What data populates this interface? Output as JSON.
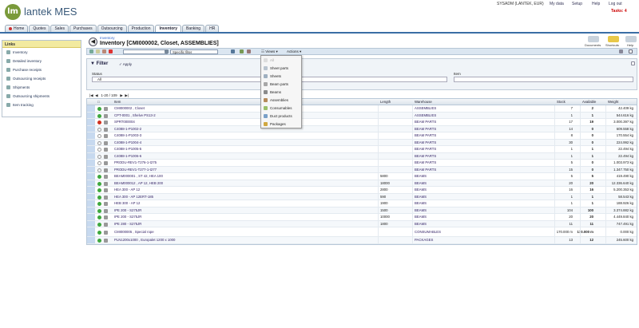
{
  "app": {
    "logo_mark": "lm",
    "logo_text": "lantek MES"
  },
  "topbar": {
    "user": "SYSADM (LANTEK, EUR)",
    "links": [
      "My data",
      "Setup",
      "Help",
      "Log out"
    ],
    "tasks": "Tasks: 4"
  },
  "nav": {
    "tabs": [
      "Home",
      "Quotes",
      "Sales",
      "Purchases",
      "Outsourcing",
      "Production",
      "Inventory",
      "Banking",
      "HR"
    ],
    "active": "Inventory"
  },
  "links_panel": {
    "header": "Links",
    "items": [
      "Inventory",
      "Detailed inventory",
      "Purchase receipts",
      "Outsourcing receipts",
      "Shipments",
      "Outsourcing shipments",
      "Item tracking"
    ]
  },
  "page": {
    "breadcrumb": "Inventory",
    "title": "Inventory [CMI000002, Closet, ASSEMBLIES]",
    "header_buttons": [
      "Documents",
      "Shortcuts",
      "Help"
    ]
  },
  "toolbar": {
    "filter_value": "Specific filter",
    "views_label": "Views",
    "actions_label": "Actions"
  },
  "views_menu": {
    "items": [
      "All",
      "Sheet parts",
      "Sheets",
      "Beam parts",
      "Beams",
      "Assemblies",
      "Consumables",
      "Duct products",
      "Packages"
    ]
  },
  "filter": {
    "title": "Filter",
    "apply": "Apply",
    "status_label": "Status",
    "status_value": "All",
    "item_label": "Item"
  },
  "pager": {
    "range": "1-20 / 109"
  },
  "grid": {
    "columns": [
      "Item",
      "Length",
      "Warehouse",
      "Stock",
      "Available",
      "Weight"
    ],
    "rows": [
      {
        "item": "CMI000002 , Closet",
        "length": "",
        "warehouse": "ASSEMBLIES",
        "stock": "7",
        "available": "2",
        "weight": "42.409 kg",
        "status": "green"
      },
      {
        "item": "CPT-0001 , Shelve PS13-2",
        "length": "",
        "warehouse": "ASSEMBLIES",
        "stock": "1",
        "available": "1",
        "weight": "544.616 kg",
        "status": "green"
      },
      {
        "item": "SPRT000004",
        "length": "",
        "warehouse": "BEAM PARTS",
        "stock": "17",
        "available": "19",
        "weight": "3.000.397 kg",
        "status": "red"
      },
      {
        "item": "C4088-1-P1002-2",
        "length": "",
        "warehouse": "BEAM PARTS",
        "stock": "14",
        "available": "0",
        "weight": "609.558 kg",
        "status": "none"
      },
      {
        "item": "C4088-1-P1003-3",
        "length": "",
        "warehouse": "BEAM PARTS",
        "stock": "8",
        "available": "0",
        "weight": "170.554 kg",
        "status": "none"
      },
      {
        "item": "C4088-1-P1004-4",
        "length": "",
        "warehouse": "BEAM PARTS",
        "stock": "30",
        "available": "0",
        "weight": "224.992 kg",
        "status": "none"
      },
      {
        "item": "C4088-1-P1005-5",
        "length": "",
        "warehouse": "BEAM PARTS",
        "stock": "1",
        "available": "1",
        "weight": "22.494 kg",
        "status": "none"
      },
      {
        "item": "C4088-1-P1006-6",
        "length": "",
        "warehouse": "BEAM PARTS",
        "stock": "1",
        "available": "1",
        "weight": "22.494 kg",
        "status": "none"
      },
      {
        "item": "PRODU-REV1-T276-1-t275",
        "length": "",
        "warehouse": "BEAM PARTS",
        "stock": "5",
        "available": "0",
        "weight": "1.003.973 kg",
        "status": "none"
      },
      {
        "item": "PRODU-REV1-T277-1-t277",
        "length": "",
        "warehouse": "BEAM PARTS",
        "stock": "15",
        "available": "0",
        "weight": "1.347.750 kg",
        "status": "none"
      },
      {
        "item": "BEAM000001 , ST 42, HEA 100",
        "length": "5800",
        "warehouse": "BEAMS",
        "stock": "5",
        "available": "5",
        "weight": "419.490 kg",
        "status": "green"
      },
      {
        "item": "BEAM000012 , AP 12, HEB 200",
        "length": "18000",
        "warehouse": "BEAMS",
        "stock": "20",
        "available": "20",
        "weight": "12.336.640 kg",
        "status": "green"
      },
      {
        "item": "HEA 300 - AP 12",
        "length": "2800",
        "warehouse": "BEAMS",
        "stock": "16",
        "available": "16",
        "weight": "5.200.353 kg",
        "status": "green"
      },
      {
        "item": "HEA 300 - AP 12ERT-185",
        "length": "590",
        "warehouse": "BEAMS",
        "stock": "1",
        "available": "1",
        "weight": "58.543 kg",
        "status": "green"
      },
      {
        "item": "HEB 300 - AP 12",
        "length": "1900",
        "warehouse": "BEAMS",
        "stock": "1",
        "available": "1",
        "weight": "188.926 kg",
        "status": "green"
      },
      {
        "item": "IPE 200 - S275JR",
        "length": "1500",
        "warehouse": "BEAMS",
        "stock": "104",
        "available": "100",
        "weight": "3.374.882 kg",
        "status": "green"
      },
      {
        "item": "IPE 200 - S275JR",
        "length": "10000",
        "warehouse": "BEAMS",
        "stock": "20",
        "available": "20",
        "weight": "4.449.840 kg",
        "status": "green"
      },
      {
        "item": "IPE 280 - S275JR",
        "length": "1800",
        "warehouse": "BEAMS",
        "stock": "11",
        "available": "11",
        "weight": "747.491 kg",
        "status": "green"
      },
      {
        "item": "CMI000005 , Special rope",
        "length": "",
        "warehouse": "CONSUMABLES",
        "stock": "170.000 m",
        "available": "170.000 m",
        "weight": "0.000 kg",
        "status": "green",
        "tall": true
      },
      {
        "item": "PLN1200x1000 , Europalet 1200 x 1000",
        "length": "",
        "warehouse": "PACKAGES",
        "stock": "13",
        "available": "12",
        "weight": "245.600 kg",
        "status": "green"
      }
    ]
  },
  "colors": {
    "green": "#3ea83e",
    "red": "#d03020",
    "accent": "#3a6ea5",
    "link": "#223366"
  }
}
